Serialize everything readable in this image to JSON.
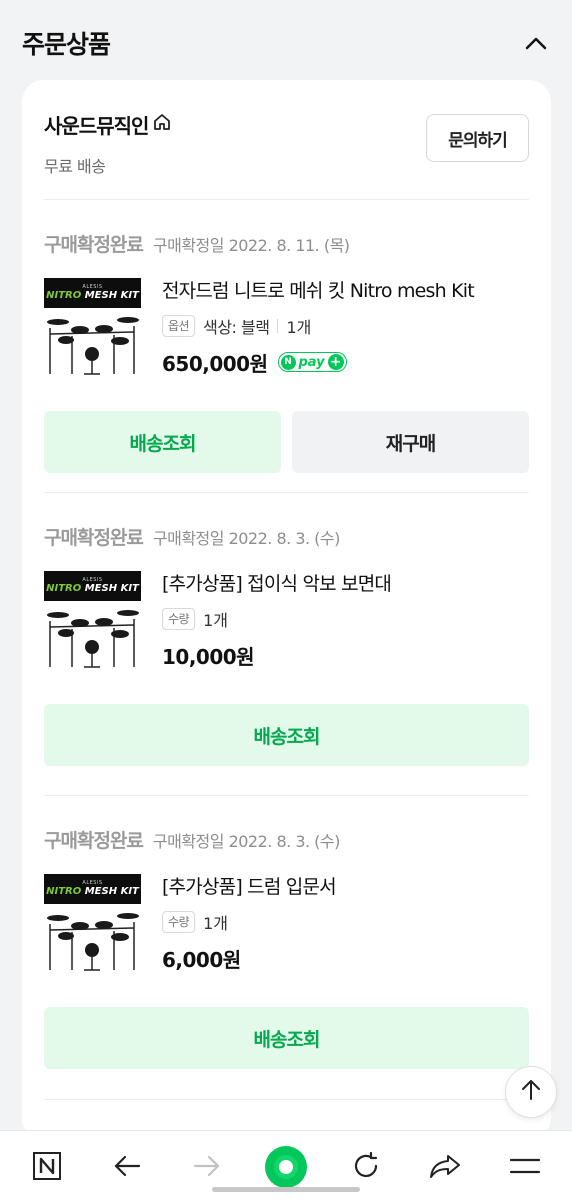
{
  "section": {
    "title": "주문상품"
  },
  "seller": {
    "name": "사운드뮤직인",
    "shipping": "무료 배송",
    "inquiry_label": "문의하기"
  },
  "thumbnail": {
    "brand": "ALESIS",
    "title_left": "NITRO",
    "title_right": "MESH KIT"
  },
  "orders": [
    {
      "status": "구매확정완료",
      "confirm_date": "구매확정일 2022. 8. 11. (목)",
      "product_name": "전자드럼 니트로 메쉬 킷 Nitro mesh Kit",
      "option_tag": "옵션",
      "option_text": "색상: 블랙",
      "quantity": "1개",
      "price": "650,000원",
      "npay": {
        "n": "N",
        "text": "pay",
        "plus": "+"
      },
      "buttons": {
        "track": "배송조회",
        "rebuy": "재구매"
      }
    },
    {
      "status": "구매확정완료",
      "confirm_date": "구매확정일 2022. 8. 3. (수)",
      "product_name": "[추가상품] 접이식 악보 보면대",
      "option_tag": "수량",
      "quantity": "1개",
      "price": "10,000원",
      "buttons": {
        "track": "배송조회"
      }
    },
    {
      "status": "구매확정완료",
      "confirm_date": "구매확정일 2022. 8. 3. (수)",
      "product_name": "[추가상품] 드럼 입문서",
      "option_tag": "수량",
      "quantity": "1개",
      "price": "6,000원",
      "buttons": {
        "track": "배송조회"
      }
    }
  ],
  "colors": {
    "accent": "#03c75a",
    "button_green_bg": "#e3f9ea",
    "button_green_text": "#03a94e",
    "status_gray": "#9a9a9a"
  },
  "icons": {
    "collapse": "chevron-up-icon",
    "home": "home-icon",
    "scroll_top": "arrow-up-icon",
    "bottom_bar": [
      "naver-n-icon",
      "back-arrow-icon",
      "forward-arrow-icon",
      "green-home-dot-icon",
      "refresh-icon",
      "share-icon",
      "menu-icon"
    ]
  }
}
